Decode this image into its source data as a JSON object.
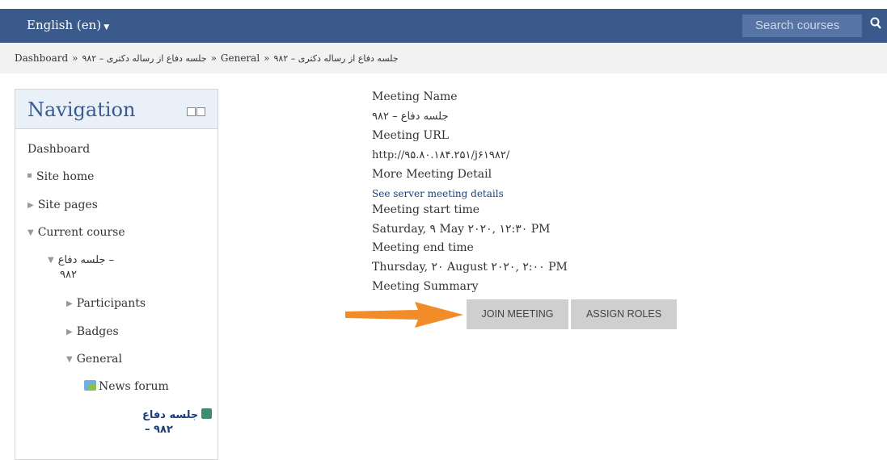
{
  "header": {
    "language_label": "English (en)",
    "search_placeholder": "Search courses"
  },
  "breadcrumb": {
    "items": [
      "Dashboard",
      "جلسه دفاع از رساله دکتری – ۹۸۲",
      "General",
      "جلسه دفاع از رساله دکتری – ۹۸۲"
    ],
    "separator": "»"
  },
  "navigation": {
    "title": "Navigation",
    "dashboard": "Dashboard",
    "site_home": "Site home",
    "site_pages": "Site pages",
    "current_course": "Current course",
    "course_name_line1": "جلسه دفاع –",
    "course_name_line2": "۹۸۲",
    "participants": "Participants",
    "badges": "Badges",
    "general": "General",
    "news_forum": "News forum",
    "meeting_line1": "جلسه دفاع",
    "meeting_line2": "– ۹۸۲"
  },
  "meeting": {
    "name_label": "Meeting Name",
    "name_value": "جلسه دفاع – ۹۸۲",
    "url_label": "Meeting URL",
    "url_value": "http://۹۵.۸۰.۱۸۴.۲۵۱/j۶۱۹۸۲/",
    "detail_label": "More Meeting Detail",
    "detail_link": "See server meeting details",
    "start_label": "Meeting start time",
    "start_value": "Saturday, ۹ May ۲۰۲۰, ۱۲:۳۰ PM",
    "end_label": "Meeting end time",
    "end_value": "Thursday, ۲۰ August ۲۰۲۰, ۲:۰۰ PM",
    "summary_label": "Meeting Summary",
    "join_button": "JOIN MEETING",
    "assign_button": "ASSIGN ROLES"
  },
  "colors": {
    "navbar": "#3a5a8c",
    "arrow": "#f28c28",
    "button": "#cfcfcf"
  }
}
